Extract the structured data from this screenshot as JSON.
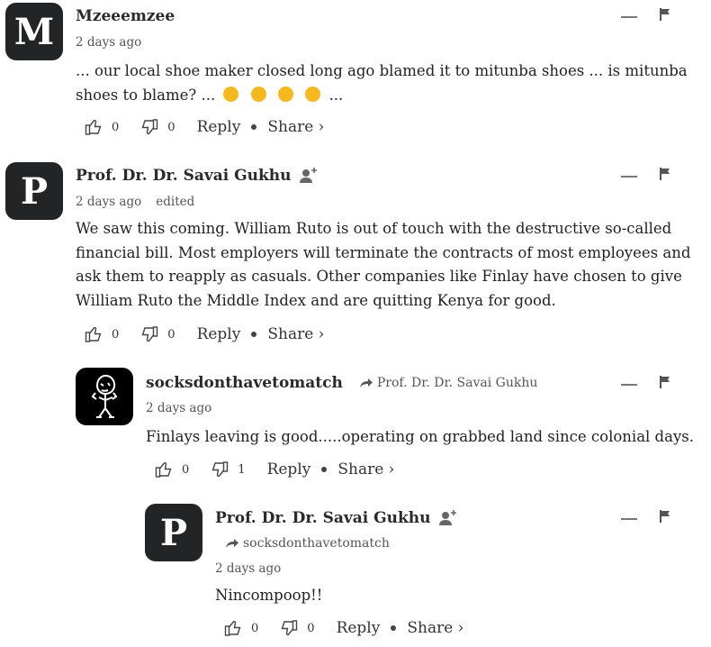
{
  "comments": [
    {
      "avatar_letter": "M",
      "author": "Mzeeemzee",
      "time": "2 days ago",
      "body_text": "... our local shoe maker closed long ago blamed it to mitunba shoes ... is mitunba",
      "body_text2": "shoes to blame? ...",
      "body_end": "...",
      "likes": "0",
      "dislikes": "0",
      "reply_label": "Reply",
      "share_label": "Share ›"
    },
    {
      "avatar_letter": "P",
      "author": "Prof. Dr. Dr. Savai Gukhu",
      "time": "2 days ago",
      "edited": "edited",
      "body": "We saw this coming. William Ruto is out of touch with the destructive so-called financial bill. Most employers will terminate the contracts of most employees and ask them to reapply as casuals. Other companies like Finlay have chosen to give William Ruto the Middle Index and are quitting Kenya for good.",
      "likes": "0",
      "dislikes": "0",
      "reply_label": "Reply",
      "share_label": "Share ›"
    },
    {
      "author": "socksdonthavetomatch",
      "reply_to": "Prof. Dr. Dr. Savai Gukhu",
      "time": "2 days ago",
      "body": "Finlays leaving is good.....operating on grabbed land since colonial days.",
      "likes": "0",
      "dislikes": "1",
      "reply_label": "Reply",
      "share_label": "Share ›"
    },
    {
      "avatar_letter": "P",
      "author": "Prof. Dr. Dr. Savai Gukhu",
      "reply_to": "socksdonthavetomatch",
      "time": "2 days ago",
      "body": "Nincompoop!!",
      "likes": "0",
      "dislikes": "0",
      "reply_label": "Reply",
      "share_label": "Share ›"
    }
  ]
}
